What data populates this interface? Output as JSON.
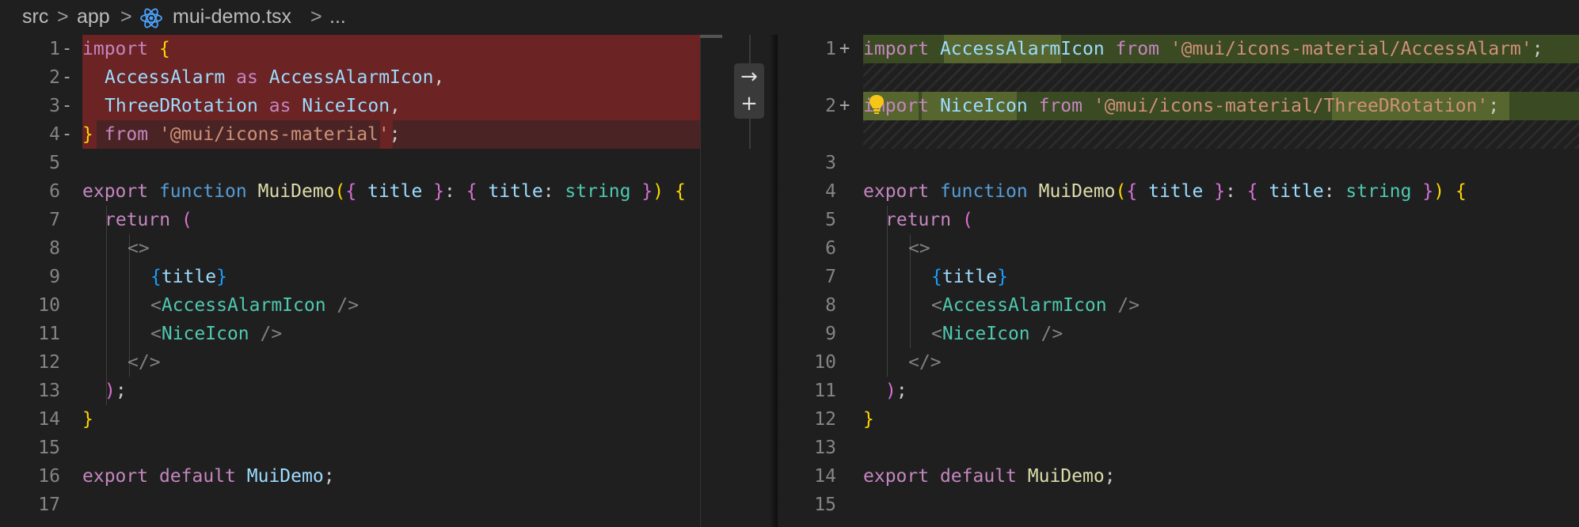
{
  "breadcrumb": {
    "items": [
      "src",
      "app",
      "mui-demo.tsx",
      "..."
    ],
    "separator": ">"
  },
  "colors": {
    "background": "#1f1f1f",
    "deleted_line": "#6b2323",
    "inserted_line": "#3a4a22",
    "keyword": "#c586c0",
    "identifier": "#9cdcfe",
    "function": "#dcdcaa",
    "string": "#ce9178",
    "type": "#4ec9b0"
  },
  "diff_actions": {
    "revert_icon": "arrow-right-icon",
    "stage_icon": "plus-icon"
  },
  "left": {
    "line_numbers": [
      "1",
      "2",
      "3",
      "4",
      "5",
      "6",
      "7",
      "8",
      "9",
      "10",
      "11",
      "12",
      "13",
      "14",
      "15",
      "16",
      "17"
    ],
    "markers": [
      "-",
      "-",
      "-",
      "-",
      "",
      "",
      "",
      "",
      "",
      "",
      "",
      "",
      "",
      "",
      "",
      "",
      ""
    ],
    "lines": {
      "l1": [
        "import",
        " ",
        "{"
      ],
      "l2": [
        "AccessAlarm",
        " as ",
        "AccessAlarmIcon",
        ","
      ],
      "l3": [
        "ThreeDRotation",
        " as ",
        "NiceIcon",
        ","
      ],
      "l4": [
        "}",
        " from ",
        "'@mui/icons-material'",
        ";"
      ],
      "l6": [
        "export",
        " ",
        "function",
        " ",
        "MuiDemo",
        "(",
        "{",
        " title ",
        "}",
        ": ",
        "{",
        " title",
        ": ",
        "string",
        " ",
        "}",
        ")",
        " ",
        "{"
      ],
      "l7": [
        "return",
        " ",
        "("
      ],
      "l8": [
        "<>"
      ],
      "l9": [
        "{",
        "title",
        "}"
      ],
      "l10": [
        "<",
        "AccessAlarmIcon",
        " />"
      ],
      "l11": [
        "<",
        "NiceIcon",
        " />"
      ],
      "l12": [
        "</>"
      ],
      "l13": [
        ")",
        ";"
      ],
      "l14": [
        "}"
      ],
      "l16": [
        "export",
        " ",
        "default",
        " ",
        "MuiDemo",
        ";"
      ]
    }
  },
  "right": {
    "line_numbers": [
      "1",
      "2",
      "3",
      "4",
      "5",
      "6",
      "7",
      "8",
      "9",
      "10",
      "11",
      "12",
      "13",
      "14",
      "15"
    ],
    "markers": [
      "+",
      "+",
      "",
      "",
      "",
      "",
      "",
      "",
      "",
      "",
      "",
      "",
      "",
      "",
      ""
    ],
    "lines": {
      "r1": [
        "import",
        " ",
        "AccessAlarmIcon",
        " ",
        "from",
        " ",
        "'@mui/icons-material/AccessAlarm'",
        ";"
      ],
      "r2": [
        "import",
        " ",
        "NiceIcon",
        " ",
        "from",
        " ",
        "'@mui/icons-material/ThreeDRotation'",
        ";"
      ],
      "r4": [
        "export",
        " ",
        "function",
        " ",
        "MuiDemo",
        "(",
        "{",
        " title ",
        "}",
        ": ",
        "{",
        " title",
        ": ",
        "string",
        " ",
        "}",
        ")",
        " ",
        "{"
      ],
      "r5": [
        "return",
        " ",
        "("
      ],
      "r6": [
        "<>"
      ],
      "r7": [
        "{",
        "title",
        "}"
      ],
      "r8": [
        "<",
        "AccessAlarmIcon",
        " />"
      ],
      "r9": [
        "<",
        "NiceIcon",
        " />"
      ],
      "r10": [
        "</>"
      ],
      "r11": [
        ")",
        ";"
      ],
      "r12": [
        "}"
      ],
      "r14": [
        "export",
        " ",
        "default",
        " ",
        "MuiDemo",
        ";"
      ]
    }
  }
}
